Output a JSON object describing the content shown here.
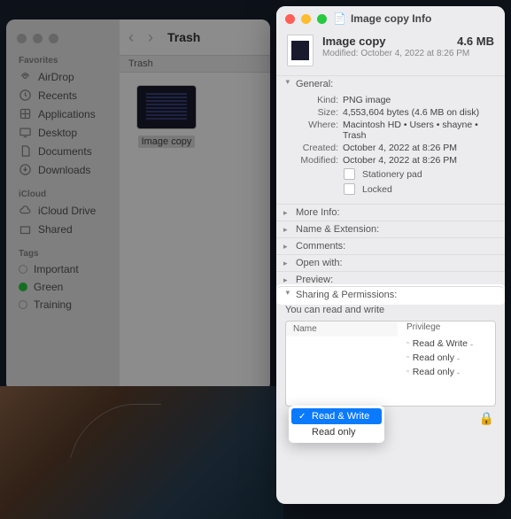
{
  "finder": {
    "title": "Trash",
    "pathbar": "Trash",
    "sidebar": {
      "favorites_label": "Favorites",
      "items_fav": [
        {
          "label": "AirDrop",
          "icon": "airdrop"
        },
        {
          "label": "Recents",
          "icon": "recents"
        },
        {
          "label": "Applications",
          "icon": "apps"
        },
        {
          "label": "Desktop",
          "icon": "desktop"
        },
        {
          "label": "Documents",
          "icon": "docs"
        },
        {
          "label": "Downloads",
          "icon": "downloads"
        }
      ],
      "icloud_label": "iCloud",
      "items_icloud": [
        {
          "label": "iCloud Drive",
          "icon": "cloud"
        },
        {
          "label": "Shared",
          "icon": "shared"
        }
      ],
      "tags_label": "Tags",
      "tags": [
        {
          "label": "Important",
          "color": ""
        },
        {
          "label": "Green",
          "color": "green"
        },
        {
          "label": "Training",
          "color": ""
        }
      ]
    },
    "file": {
      "label": "Image copy"
    }
  },
  "info": {
    "window_title": "Image copy Info",
    "name": "Image copy",
    "size": "4.6 MB",
    "modified_line": "Modified: October 4, 2022 at 8:26 PM",
    "general": {
      "label": "General:",
      "kind": {
        "k": "Kind:",
        "v": "PNG image"
      },
      "size": {
        "k": "Size:",
        "v": "4,553,604 bytes (4.6 MB on disk)"
      },
      "where": {
        "k": "Where:",
        "v": "Macintosh HD • Users • shayne • Trash"
      },
      "created": {
        "k": "Created:",
        "v": "October 4, 2022 at 8:26 PM"
      },
      "modified": {
        "k": "Modified:",
        "v": "October 4, 2022 at 8:26 PM"
      },
      "stationery": "Stationery pad",
      "locked": "Locked"
    },
    "sections": {
      "more_info": "More Info:",
      "name_ext": "Name & Extension:",
      "comments": "Comments:",
      "open_with": "Open with:",
      "preview": "Preview:",
      "sharing": "Sharing & Permissions:"
    },
    "perm": {
      "caption": "You can read and write",
      "col_name": "Name",
      "col_priv": "Privilege",
      "rows": [
        {
          "priv": "Read & Write"
        },
        {
          "priv": "Read only"
        },
        {
          "priv": "Read only"
        }
      ],
      "dropdown": {
        "opt1": "Read & Write",
        "opt2": "Read only"
      }
    }
  }
}
